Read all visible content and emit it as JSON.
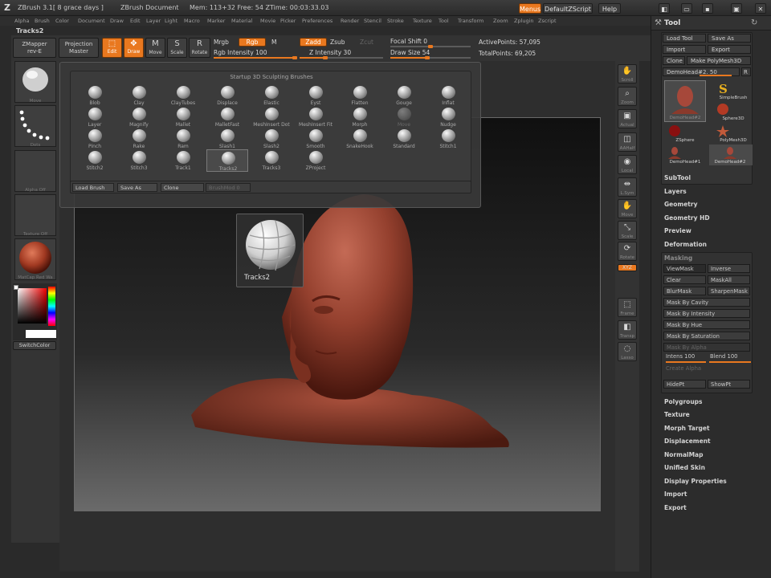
{
  "titlebar": {
    "app_version": "ZBrush  3.1[ 8 grace days ]",
    "document": "ZBrush Document",
    "mem_info": "Mem: 113+32 Free: 54 ZTime: 00:03:33.03",
    "menus_button": "Menus",
    "script_label": "DefaultZScript",
    "help_button": "Help"
  },
  "menubar": [
    "Alpha",
    "Brush",
    "Color",
    "Document",
    "Draw",
    "Edit",
    "Layer",
    "Light",
    "Macro",
    "Marker",
    "Material",
    "Movie",
    "Picker",
    "Preferences",
    "Render",
    "Stencil",
    "Stroke",
    "Texture",
    "Tool",
    "Transform",
    "Zoom",
    "Zplugin",
    "Zscript"
  ],
  "current_brush": "Tracks2",
  "top_shelf": {
    "zmapper_line1": "ZMapper",
    "zmapper_line2": "rev-E",
    "projection_line1": "Projection",
    "projection_line2": "Master",
    "edit": "Edit",
    "draw": "Draw",
    "move": "Move",
    "scale": "Scale",
    "rotate": "Rotate",
    "mrgb": "Mrgb",
    "rgb": "Rgb",
    "m": "M",
    "zadd": "Zadd",
    "zsub": "Zsub",
    "zcut": "Zcut",
    "rgb_intensity": "Rgb Intensity 100",
    "z_intensity": "Z Intensity 30",
    "focal_shift": "Focal Shift 0",
    "draw_size": "Draw Size 54",
    "active_points": "ActivePoints: 57,095",
    "total_points": "TotalPoints: 69,205"
  },
  "left_shelf": {
    "brush_caption": "Move",
    "stroke_caption": "Dots",
    "alpha_caption": "Alpha Off",
    "texture_caption": "Texture Off",
    "material_caption": "MatCap Red Wa",
    "switch_color": "SwitchColor"
  },
  "brush_palette": {
    "title": "Startup 3D Sculpting Brushes",
    "brushes": [
      "Blob",
      "Clay",
      "ClayTubes",
      "Displace",
      "Elastic",
      "Eyst",
      "Flatten",
      "Gouge",
      "Inflat",
      "Layer",
      "Magnify",
      "Mallet",
      "MalletFast",
      "MeshInsert Dot",
      "MeshInsert Fit",
      "Morph",
      "Move",
      "Nudge",
      "Pinch",
      "Rake",
      "Ram",
      "Slash1",
      "Slash2",
      "Smooth",
      "SnakeHook",
      "Standard",
      "Stitch1",
      "Stitch2",
      "Stitch3",
      "Track1",
      "Tracks2",
      "Tracks3",
      "ZProject"
    ],
    "selected": "Tracks2",
    "disabled": "Move",
    "load_brush": "Load Brush",
    "save_as": "Save As",
    "clone": "Clone",
    "brush_mod": "BrushMod 0"
  },
  "preview_label": "Tracks2",
  "right_shelf": [
    "Scroll",
    "Zoom",
    "Actual",
    "AAHalf",
    "Local",
    "L.Sym",
    "Move",
    "Scale",
    "Rotate",
    "Xyz",
    "Frame",
    "Transp",
    "Lasso"
  ],
  "tool_panel": {
    "title": "Tool",
    "load_tool": "Load Tool",
    "save_as": "Save As",
    "import": "Import",
    "export": "Export",
    "clone": "Clone",
    "make_polymesh": "Make PolyMesh3D",
    "current_tool": "DemoHead#2. 50",
    "r": "R",
    "tools": [
      "DemoHead#2",
      "SimpleBrush",
      "Sphere3D",
      "ZSphere",
      "PolyMesh3D",
      "DemoHead#1",
      "DemoHead#2"
    ],
    "sections_top": [
      "SubTool",
      "Layers",
      "Geometry",
      "Geometry HD",
      "Preview",
      "Deformation"
    ],
    "masking": {
      "title": "Masking",
      "viewmask": "ViewMask",
      "inverse": "Inverse",
      "clear": "Clear",
      "maskall": "MaskAll",
      "blurmask": "BlurMask",
      "sharpenmask": "SharpenMask",
      "by_cavity": "Mask By Cavity",
      "by_intensity": "Mask By Intensity",
      "by_hue": "Mask By Hue",
      "by_saturation": "Mask By Saturation",
      "by_alpha": "Mask By Alpha",
      "intens": "Intens 100",
      "blend": "Blend 100",
      "create_alpha": "Create Alpha",
      "hidept": "HidePt",
      "showpt": "ShowPt"
    },
    "sections_bottom": [
      "Polygroups",
      "Texture",
      "Morph Target",
      "Displacement",
      "NormalMap",
      "Unified Skin",
      "Display Properties",
      "Import",
      "Export"
    ]
  },
  "colors": {
    "accent": "#e9781f",
    "head": "#9a4a3a",
    "background": "#2a2a2a"
  }
}
